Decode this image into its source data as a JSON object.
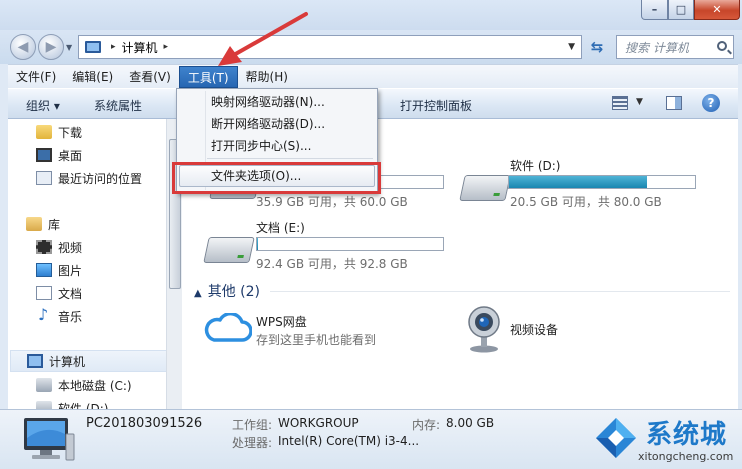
{
  "window": {
    "controls": {
      "minimize": "–",
      "maximize": "□",
      "close": "✕"
    }
  },
  "address": {
    "crumb": "计算机",
    "sep1": "▸",
    "sep2": "▸",
    "search_placeholder": "搜索 计算机"
  },
  "menubar": [
    {
      "label": "文件(F)"
    },
    {
      "label": "编辑(E)"
    },
    {
      "label": "查看(V)"
    },
    {
      "label": "工具(T)",
      "active": true
    },
    {
      "label": "帮助(H)"
    }
  ],
  "toolbar": {
    "organize": "组织 ▾",
    "system_properties": "系统属性",
    "open_control_panel": "打开控制面板"
  },
  "tools_menu": {
    "items": [
      "映射网络驱动器(N)...",
      "断开网络驱动器(D)...",
      "打开同步中心(S)...",
      "文件夹选项(O)..."
    ],
    "highlighted": "文件夹选项(O)..."
  },
  "nav_pane": {
    "items": [
      {
        "label": "下载",
        "icon": "download-folder-icon"
      },
      {
        "label": "桌面",
        "icon": "desktop-icon"
      },
      {
        "label": "最近访问的位置",
        "icon": "recent-places-icon"
      },
      {
        "label": "库",
        "icon": "library-icon"
      },
      {
        "label": "视频",
        "icon": "video-icon"
      },
      {
        "label": "图片",
        "icon": "pictures-icon"
      },
      {
        "label": "文档",
        "icon": "documents-icon"
      },
      {
        "label": "音乐",
        "icon": "music-icon"
      },
      {
        "label": "计算机",
        "icon": "computer-icon",
        "selected": true
      },
      {
        "label": "本地磁盘 (C:)",
        "icon": "drive-icon"
      },
      {
        "label": "软件 (D:)",
        "icon": "drive-icon"
      }
    ]
  },
  "drives": [
    {
      "name": "",
      "free_text": "35.9 GB 可用，共 60.0 GB",
      "used_fraction": 0.4
    },
    {
      "name": "软件 (D:)",
      "free_text": "20.5 GB 可用，共 80.0 GB",
      "used_fraction": 0.74
    },
    {
      "name": "文档 (E:)",
      "free_text": "92.4 GB 可用，共 92.8 GB",
      "used_fraction": 0.004
    }
  ],
  "other_group": {
    "title": "其他 (2)",
    "items": [
      {
        "name": "WPS网盘",
        "sub": "存到这里手机也能看到"
      },
      {
        "name": "视频设备"
      }
    ]
  },
  "details": {
    "pc_name": "PC201803091526",
    "workgroup_label": "工作组:",
    "workgroup_value": "WORKGROUP",
    "memory_label": "内存:",
    "memory_value": "8.00 GB",
    "cpu_label": "处理器:",
    "cpu_value": "Intel(R) Core(TM) i3-4..."
  },
  "watermark": {
    "brand": "系统城",
    "url": "xitongcheng.com"
  },
  "colors": {
    "menu_active": "#2766b2",
    "highlight_box": "#d93a3a",
    "drive_fill": "#1a86b0",
    "brand_blue": "#1e79c9"
  }
}
